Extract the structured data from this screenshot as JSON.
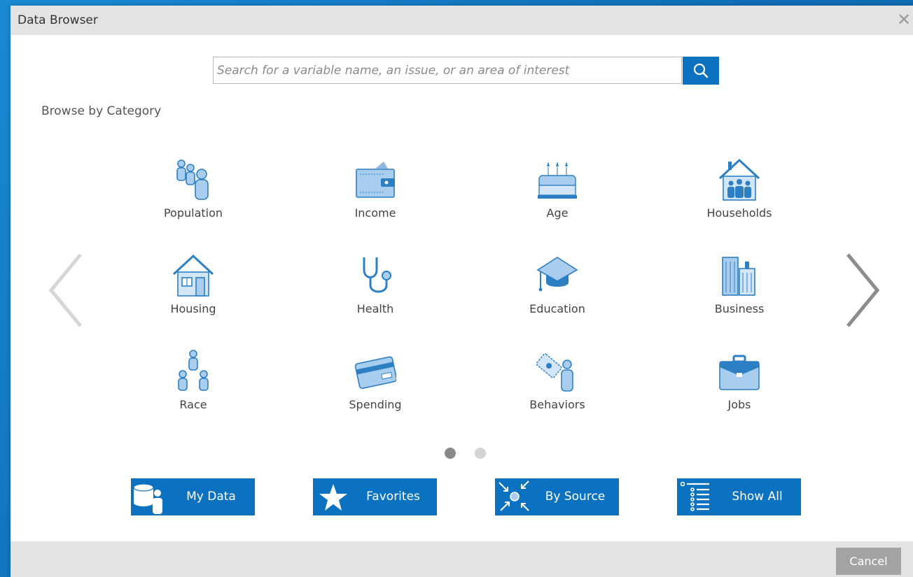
{
  "dialog": {
    "title": "Data Browser",
    "close_icon": "close-icon"
  },
  "search": {
    "placeholder": "Search for a variable name, an issue, or an area of interest",
    "value": "",
    "button_icon": "search-icon"
  },
  "browse": {
    "label": "Browse by Category"
  },
  "categories": [
    {
      "label": "Population",
      "icon": "population-icon"
    },
    {
      "label": "Income",
      "icon": "wallet-icon"
    },
    {
      "label": "Age",
      "icon": "birthday-cake-icon"
    },
    {
      "label": "Households",
      "icon": "family-house-icon"
    },
    {
      "label": "Housing",
      "icon": "house-icon"
    },
    {
      "label": "Health",
      "icon": "stethoscope-icon"
    },
    {
      "label": "Education",
      "icon": "graduation-cap-icon"
    },
    {
      "label": "Business",
      "icon": "office-buildings-icon"
    },
    {
      "label": "Race",
      "icon": "people-group-icon"
    },
    {
      "label": "Spending",
      "icon": "credit-card-icon"
    },
    {
      "label": "Behaviors",
      "icon": "person-with-money-icon"
    },
    {
      "label": "Jobs",
      "icon": "briefcase-icon"
    }
  ],
  "pagination": {
    "current_page": 1,
    "total_pages": 2
  },
  "quick_buttons": [
    {
      "label": "My Data",
      "icon": "database-user-icon"
    },
    {
      "label": "Favorites",
      "icon": "star-icon"
    },
    {
      "label": "By Source",
      "icon": "source-arrows-icon"
    },
    {
      "label": "Show All",
      "icon": "list-icon"
    }
  ],
  "footer": {
    "cancel_label": "Cancel"
  },
  "colors": {
    "accent": "#0a72c0",
    "icon_light": "#a8cdee",
    "icon_stroke": "#2d7fc4",
    "dot_active": "#8a8a8a",
    "dot_inactive": "#d4d4d4",
    "arrow_left": "#d6d6d6",
    "arrow_right": "#8c8c8c"
  }
}
